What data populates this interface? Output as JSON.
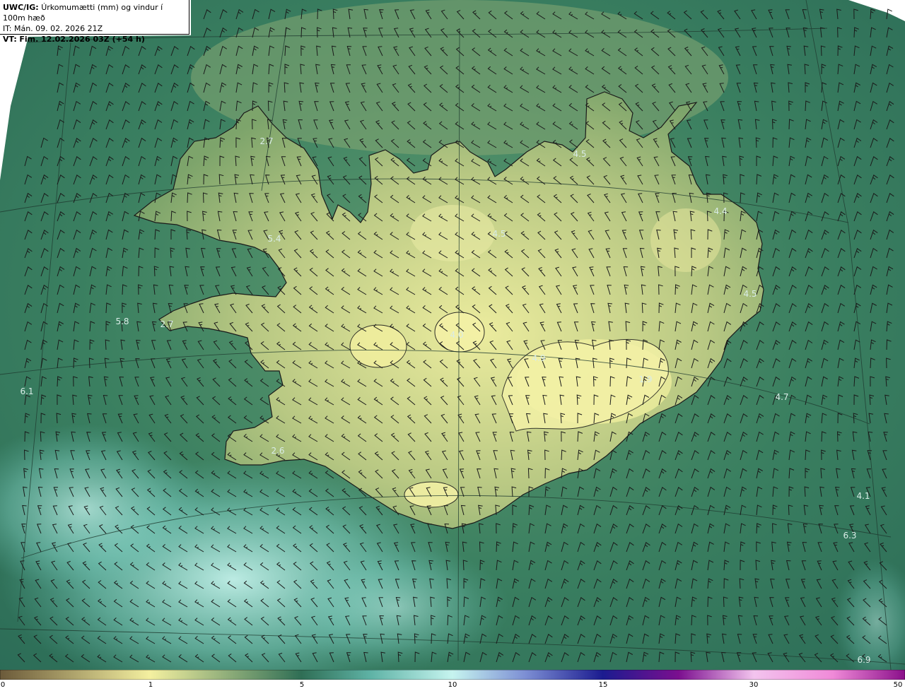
{
  "header": {
    "model": "UWC/IG:",
    "title": "Úrkomumætti (mm) og vindur í 100m hæð",
    "init_label": "IT:",
    "init_time": "Mán. 09. 02. 2026 21Z",
    "valid_label": "VT:",
    "valid_time": "Fim. 12.02.2026 03Z (+54 h)"
  },
  "values": [
    "2.7",
    "4.5",
    "4.4",
    "5.4",
    "4.5",
    "4.5",
    "5.8",
    "2.7",
    "6.1",
    "2.6",
    "4.7",
    "4.1",
    "6.3",
    "6.9",
    "4.0",
    "4.9",
    "1.9"
  ],
  "colorbar": {
    "ticks": [
      "0",
      "1",
      "5",
      "10",
      "15",
      "30",
      "50"
    ],
    "colors": [
      "#6b5a3a",
      "#c9b878",
      "#f4f0a0",
      "#2f6e55",
      "#5fb3a6",
      "#c6f4ef",
      "#1b1b8f",
      "#7b0f8f",
      "#f08ad8",
      "#8a0f8a"
    ]
  },
  "palette": {
    "sea_dark": "#2f6e58",
    "sea_light": "#8fd8d0",
    "land_low": "#6f9a62",
    "land_high": "#e7e99a",
    "coast": "#1a1a1a"
  }
}
